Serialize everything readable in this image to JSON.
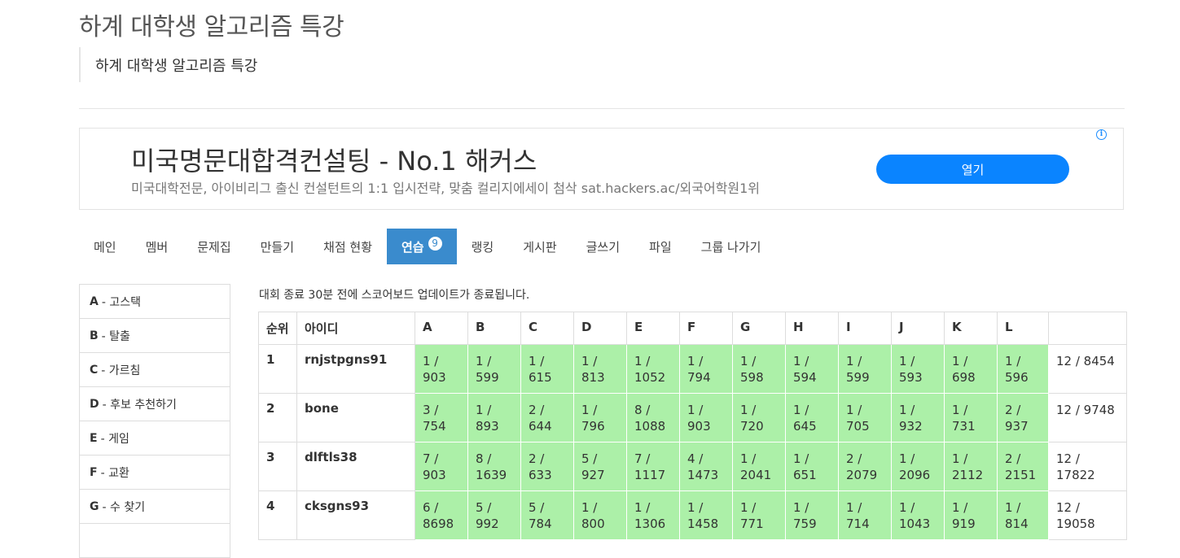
{
  "page": {
    "title": "하계 대학생 알고리즘 특강",
    "subtitle": "하계 대학생 알고리즘 특강"
  },
  "ad": {
    "title": "미국명문대합격컨설팅 - No.1 해커스",
    "description": "미국대학전문, 아이비리그 출신 컨설턴트의 1:1 입시전략, 맞춤 컬리지에세이 첨삭 sat.hackers.ac/외국어학원1위",
    "button_label": "열기",
    "info_icon": "ⓘ"
  },
  "nav": {
    "tabs": [
      "메인",
      "멤버",
      "문제집",
      "만들기",
      "채점 현황",
      "연습",
      "랭킹",
      "게시판",
      "글쓰기",
      "파일",
      "그룹 나가기"
    ],
    "active_tab": "연습",
    "badge": "9"
  },
  "sidebar": {
    "items": [
      {
        "letter": "A",
        "name": "- 고스택"
      },
      {
        "letter": "B",
        "name": "- 탈출"
      },
      {
        "letter": "C",
        "name": "- 가르침"
      },
      {
        "letter": "D",
        "name": "- 후보 추천하기"
      },
      {
        "letter": "E",
        "name": "- 게임"
      },
      {
        "letter": "F",
        "name": "- 교환"
      },
      {
        "letter": "G",
        "name": "- 수 찾기"
      }
    ]
  },
  "scoreboard": {
    "notice": "대회 종료 30분 전에 스코어보드 업데이트가 종료됩니다.",
    "headers": {
      "rank": "순위",
      "id": "아이디",
      "problems": [
        "A",
        "B",
        "C",
        "D",
        "E",
        "F",
        "G",
        "H",
        "I",
        "J",
        "K",
        "L"
      ],
      "total": ""
    },
    "rows": [
      {
        "rank": "1",
        "id": "rnjstpgns91",
        "cells": [
          [
            "1 /",
            "903"
          ],
          [
            "1 /",
            "599"
          ],
          [
            "1 /",
            "615"
          ],
          [
            "1 /",
            "813"
          ],
          [
            "1 /",
            "1052"
          ],
          [
            "1 /",
            "794"
          ],
          [
            "1 /",
            "598"
          ],
          [
            "1 /",
            "594"
          ],
          [
            "1 /",
            "599"
          ],
          [
            "1 /",
            "593"
          ],
          [
            "1 /",
            "698"
          ],
          [
            "1 /",
            "596"
          ]
        ],
        "total": "12 / 8454"
      },
      {
        "rank": "2",
        "id": "bone",
        "cells": [
          [
            "3 /",
            "754"
          ],
          [
            "1 /",
            "893"
          ],
          [
            "2 /",
            "644"
          ],
          [
            "1 /",
            "796"
          ],
          [
            "8 /",
            "1088"
          ],
          [
            "1 /",
            "903"
          ],
          [
            "1 /",
            "720"
          ],
          [
            "1 /",
            "645"
          ],
          [
            "1 /",
            "705"
          ],
          [
            "1 /",
            "932"
          ],
          [
            "1 /",
            "731"
          ],
          [
            "2 /",
            "937"
          ]
        ],
        "total": "12 / 9748"
      },
      {
        "rank": "3",
        "id": "dlftls38",
        "cells": [
          [
            "7 /",
            "903"
          ],
          [
            "8 /",
            "1639"
          ],
          [
            "2 /",
            "633"
          ],
          [
            "5 /",
            "927"
          ],
          [
            "7 /",
            "1117"
          ],
          [
            "4 /",
            "1473"
          ],
          [
            "1 /",
            "2041"
          ],
          [
            "1 /",
            "651"
          ],
          [
            "2 /",
            "2079"
          ],
          [
            "1 /",
            "2096"
          ],
          [
            "1 /",
            "2112"
          ],
          [
            "2 /",
            "2151"
          ]
        ],
        "total": "12 / 17822"
      },
      {
        "rank": "4",
        "id": "cksgns93",
        "cells": [
          [
            "6 /",
            "8698"
          ],
          [
            "5 /",
            "992"
          ],
          [
            "5 /",
            "784"
          ],
          [
            "1 /",
            "800"
          ],
          [
            "1 /",
            "1306"
          ],
          [
            "1 /",
            "1458"
          ],
          [
            "1 /",
            "771"
          ],
          [
            "1 /",
            "759"
          ],
          [
            "1 /",
            "714"
          ],
          [
            "1 /",
            "1043"
          ],
          [
            "1 /",
            "919"
          ],
          [
            "1 /",
            "814"
          ]
        ],
        "total": "12 / 19058"
      }
    ],
    "accepted_color": "#acf0a8"
  }
}
